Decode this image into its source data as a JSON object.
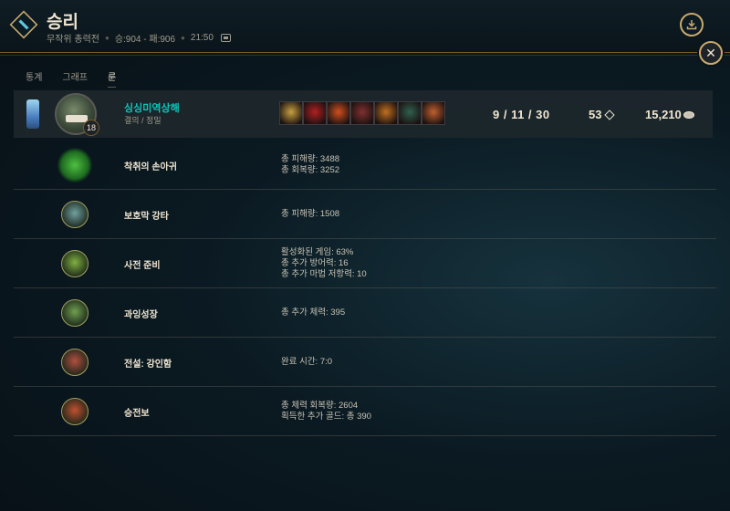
{
  "header": {
    "title": "승리",
    "mode": "무작위 총력전",
    "record": "승:904 - 패:906",
    "time": "21:50",
    "mode_icon": "aram-mode-icon",
    "download_icon": "download-icon",
    "close_icon": "close-icon"
  },
  "tabs": [
    {
      "label": "통계"
    },
    {
      "label": "그래프"
    },
    {
      "label": "룬"
    }
  ],
  "active_tab": "룬",
  "player": {
    "name": "싱싱미역상해",
    "runes": "결의 / 정밀",
    "level": "18",
    "kda": "9 / 11 / 30",
    "cs": "53",
    "gold": "15,210",
    "items": [
      {
        "icon": "item-1-icon",
        "color": "#c8a040"
      },
      {
        "icon": "item-2-icon",
        "color": "#b02020"
      },
      {
        "icon": "item-3-icon",
        "color": "#d05020"
      },
      {
        "icon": "item-4-icon",
        "color": "#803030"
      },
      {
        "icon": "item-5-icon",
        "color": "#c07020"
      },
      {
        "icon": "item-6-icon",
        "color": "#306050"
      },
      {
        "icon": "item-7-icon",
        "color": "#c06030"
      }
    ]
  },
  "runes": [
    {
      "name": "착취의 손아귀",
      "stats": [
        "총 피해량: 3488",
        "총 회복량: 3252"
      ],
      "icon": "grasp-of-the-undying-icon",
      "color": "#4ec040"
    },
    {
      "name": "보호막 강타",
      "stats": [
        "총 피해량: 1508"
      ],
      "icon": "shield-bash-icon",
      "color": "#70a0a0"
    },
    {
      "name": "사전 준비",
      "stats": [
        "활성화된 게임: 63%",
        "총 추가 방어력: 16",
        "총 추가 마법 저항력: 10"
      ],
      "icon": "conditioning-icon",
      "color": "#80b040"
    },
    {
      "name": "과잉성장",
      "stats": [
        "총 추가 체력: 395"
      ],
      "icon": "overgrowth-icon",
      "color": "#70a050"
    },
    {
      "name": "전설: 강인함",
      "stats": [
        "완료 시간: 7:0"
      ],
      "icon": "legend-tenacity-icon",
      "color": "#b05040"
    },
    {
      "name": "승전보",
      "stats": [
        "총 체력 회복량: 2604",
        "획득한 추가 골드: 총 390"
      ],
      "icon": "triumph-icon",
      "color": "#c05030"
    }
  ]
}
